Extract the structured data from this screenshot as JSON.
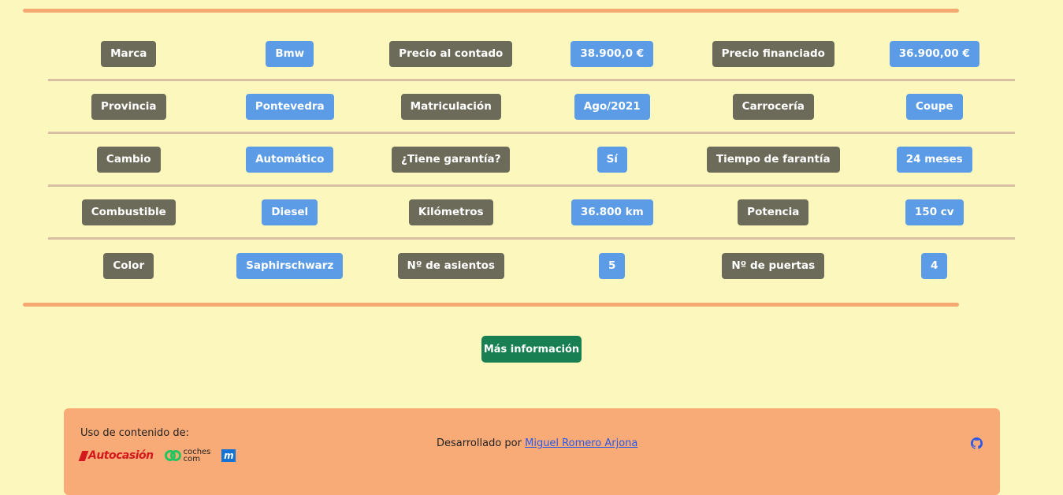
{
  "specs": {
    "rows": [
      [
        {
          "label": "Marca",
          "value": "Bmw"
        },
        {
          "label": "Precio al contado",
          "value": "38.900,0 €"
        },
        {
          "label": "Precio financiado",
          "value": "36.900,00 €"
        }
      ],
      [
        {
          "label": "Provincia",
          "value": "Pontevedra"
        },
        {
          "label": "Matriculación",
          "value": "Ago/2021"
        },
        {
          "label": "Carrocería",
          "value": "Coupe"
        }
      ],
      [
        {
          "label": "Cambio",
          "value": "Automático"
        },
        {
          "label": "¿Tiene garantía?",
          "value": "Sí"
        },
        {
          "label": "Tiempo de farantía",
          "value": "24 meses"
        }
      ],
      [
        {
          "label": "Combustible",
          "value": "Diesel"
        },
        {
          "label": "Kilómetros",
          "value": "36.800 km"
        },
        {
          "label": "Potencia",
          "value": "150 cv"
        }
      ],
      [
        {
          "label": "Color",
          "value": "Saphirschwarz"
        },
        {
          "label": "Nº de asientos",
          "value": "5"
        },
        {
          "label": "Nº de puertas",
          "value": "4"
        }
      ]
    ]
  },
  "actions": {
    "more_info_label": "Más información"
  },
  "footer": {
    "credits_label": "Uso de contenido de:",
    "sources": [
      {
        "name": "Autocasión",
        "icon": "autocasion-logo"
      },
      {
        "name": "coches com",
        "icon": "coches-com-logo"
      },
      {
        "name": "m",
        "icon": "motor-logo"
      }
    ],
    "developed_by": "Desarrollado por",
    "developer_name": "Miguel Romero Arjona",
    "github_icon": "github-icon"
  },
  "colors": {
    "background": "#fcf8bd",
    "label_badge": "#6c6b59",
    "value_badge": "#5c9ce6",
    "accent_rule": "#f5a873",
    "row_divider": "#d9bfa3",
    "button": "#177f51",
    "footer": "#f9ab77",
    "link": "#2b58e6"
  }
}
